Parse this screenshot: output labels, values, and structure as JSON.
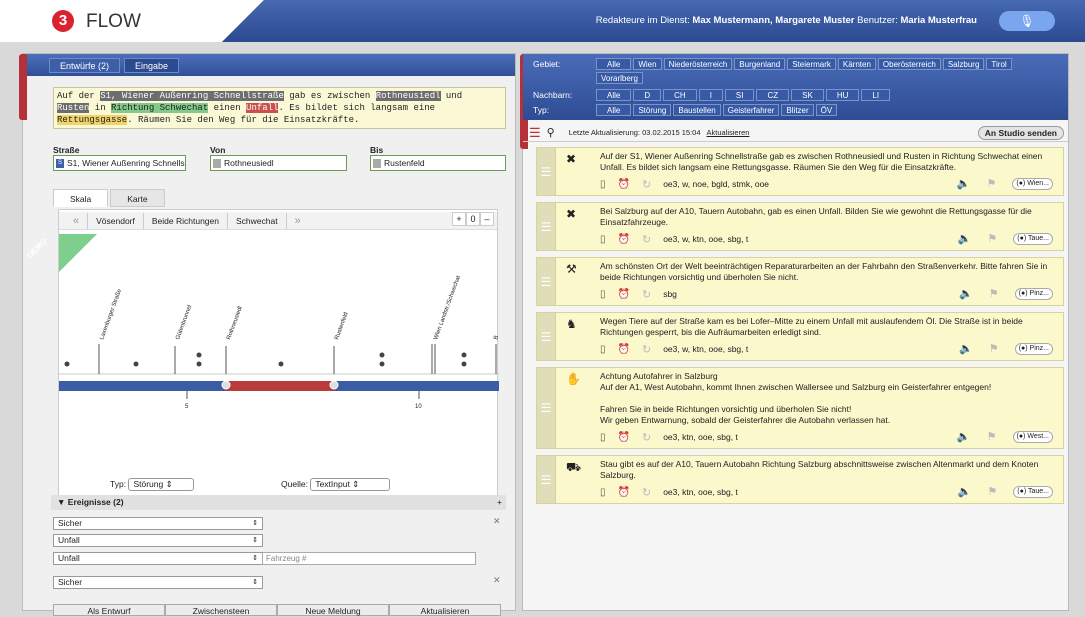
{
  "app": {
    "logo": "3",
    "title": "FLOW"
  },
  "header": {
    "duty_label": "Redakteure im Dienst:",
    "duty_names": "Max Mustermann, Margarete Muster",
    "user_label": "Benutzer:",
    "user_name": "Maria Musterfrau",
    "mic_icon": "microphone-icon"
  },
  "left": {
    "tabs": [
      "Entwürfe (2)",
      "Eingabe"
    ],
    "editor": {
      "p1": "Auf der ",
      "h1": "S1, Wiener Außenring Schnellstraße",
      "p2": " gab es zwischen ",
      "h2": "Rothneusiedl",
      "p3": " und",
      "h3": "Rusten",
      "p4": " in ",
      "h4": "Richtung Schwechat",
      "p5": " einen ",
      "h5": "Unfall",
      "p6": ". Es bildet sich langsam eine",
      "h6": "Rettungsgasse",
      "p7": ". Räumen Sie den Weg für die Einsatzkräfte."
    },
    "fields": {
      "strasse_label": "Straße",
      "strasse_value": "S1, Wiener Außenring Schnells",
      "strasse_tag": "S",
      "von_label": "Von",
      "von_value": "Rothneusiedl",
      "bis_label": "Bis",
      "bis_value": "Rustenfeld"
    },
    "view_tabs": [
      "Skala",
      "Karte"
    ],
    "nav": {
      "prev": "«",
      "from": "Vösendorf",
      "both": "Beide Richtungen",
      "to": "Schwechat",
      "next": "»"
    },
    "zoom": {
      "plus": "+",
      "value": "0",
      "minus": "–"
    },
    "demo": "DEMO",
    "scale_labels": [
      "Laxenburger Straße",
      "Gütenbrunnel",
      "Rothneusiedl",
      "Rustenfeld",
      "Wien Landstr./Schwechat",
      "B"
    ],
    "scale_ticks": [
      "5",
      "10"
    ],
    "typ_label": "Typ:",
    "typ_value": "Störung",
    "quelle_label": "Quelle:",
    "quelle_value": "TextInput",
    "events_title": "▼ Ereignisse (2)",
    "events_add": "+",
    "rows": [
      "Sicher",
      "Unfall",
      "Unfall",
      "Sicher"
    ],
    "fahrzeug_placeholder": "Fahrzeug #",
    "buttons": [
      "Als Entwurf",
      "Zwischensteen",
      "Neue Meldung",
      "Aktualisieren"
    ]
  },
  "right": {
    "gebiet_label": "Gebiet:",
    "gebiet": [
      "Alle",
      "Wien",
      "Niederösterreich",
      "Burgenland",
      "Steiermark",
      "Kärnten",
      "Oberösterreich",
      "Salzburg",
      "Tirol",
      "Vorarlberg"
    ],
    "nachbarn_label": "Nachbarn:",
    "nachbarn": [
      "Alle",
      "D",
      "CH",
      "I",
      "SI",
      "CZ",
      "SK",
      "HU",
      "LI"
    ],
    "typ_label": "Typ:",
    "typ": [
      "Alle",
      "Störung",
      "Baustellen",
      "Geisterfahrer",
      "Blitzer",
      "ÖV"
    ],
    "updated": "Letzte Aktualisierung: 03.02.2015 15:04",
    "refresh": "Aktualisieren",
    "studio": "An Studio senden",
    "cards": [
      {
        "icon": "accident-icon",
        "glyph": "✖",
        "text": "Auf der S1, Wiener Außenring Schnellstraße gab es zwischen Rothneusiedl und Rusten in Richtung Schwechat einen Unfall. Es bildet sich langsam eine Rettungsgasse. Räumen Sie den Weg für die Einsatzkräfte.",
        "regions": "oe3, w, noe, bgld, stmk, ooe",
        "pill": "(●) Wien..."
      },
      {
        "icon": "accident-icon",
        "glyph": "✖",
        "text": "Bei Salzburg auf der A10, Tauern Autobahn, gab es einen Unfall. Bilden Sie wie gewohnt die Rettungsgasse für die Einsatzfahrzeuge.",
        "regions": "oe3, w, ktn, ooe, sbg, t",
        "pill": "(●) Taue..."
      },
      {
        "icon": "roadwork-icon",
        "glyph": "⚒",
        "text": "Am schönsten Ort der Welt beeinträchtigen Reparaturarbeiten an der Fahrbahn den Straßenverkehr. Bitte fahren Sie in beide Richtungen vorsichtig und überholen Sie nicht.",
        "regions": "sbg",
        "pill": "(●) Pinz..."
      },
      {
        "icon": "animal-icon",
        "glyph": "♞",
        "text": "Wegen Tiere auf der Straße kam es bei Lofer–Mitte zu einem Unfall mit auslaufendem Öl. Die Straße ist in beide Richtungen gesperrt, bis die Aufräumarbeiten erledigt sind.",
        "regions": "oe3, w, ktn, ooe, sbg, t",
        "pill": "(●) Pinz..."
      },
      {
        "icon": "stop-hand-icon",
        "glyph": "✋",
        "text": "Achtung Autofahrer in Salzburg\nAuf der A1, West Autobahn, kommt Ihnen zwischen Wallersee und Salzburg ein Geisterfahrer entgegen!\n\nFahren Sie in beide Richtungen vorsichtig und überholen Sie nicht!\nWir geben Entwarnung, sobald der Geisterfahrer die Autobahn verlassen hat.",
        "regions": "oe3, ktn, ooe, sbg, t",
        "pill": "(●) West..."
      },
      {
        "icon": "traffic-jam-icon",
        "glyph": "⛟",
        "text": "Stau gibt es auf der A10, Tauern Autobahn Richtung Salzburg abschnittsweise zwischen Altenmarkt und dem Knoten Salzburg.",
        "regions": "oe3, ktn, ooe, sbg, t",
        "pill": "(●) Taue..."
      }
    ]
  }
}
